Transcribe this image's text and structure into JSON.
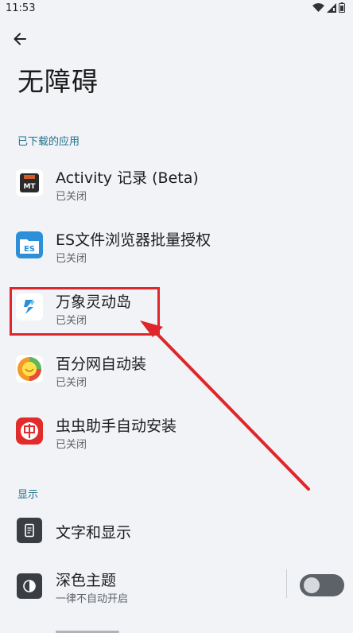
{
  "status_bar": {
    "time": "11:53",
    "icons": [
      "wifi-icon",
      "cell-signal-icon",
      "battery-icon"
    ]
  },
  "header": {
    "back_icon": "arrow-back-icon",
    "title": "无障碍"
  },
  "sections": {
    "downloaded": {
      "header": "已下载的应用",
      "items": [
        {
          "title": "Activity 记录 (Beta)",
          "subtitle": "已关闭",
          "icon": "mt-app-icon"
        },
        {
          "title": "ES文件浏览器批量授权",
          "subtitle": "已关闭",
          "icon": "es-file-explorer-icon"
        },
        {
          "title": "万象灵动岛",
          "subtitle": "已关闭",
          "icon": "wanxiang-dynamic-island-icon"
        },
        {
          "title": "百分网自动装",
          "subtitle": "已关闭",
          "icon": "baifenwang-icon"
        },
        {
          "title": "虫虫助手自动安装",
          "subtitle": "已关闭",
          "icon": "chongchong-icon"
        }
      ]
    },
    "display": {
      "header": "显示",
      "items": [
        {
          "title": "文字和显示",
          "icon": "text-display-icon"
        },
        {
          "title": "深色主题",
          "subtitle": "一律不自动开启",
          "icon": "dark-theme-icon",
          "toggle_on": false
        }
      ]
    }
  },
  "annotation": {
    "color": "#e0262a",
    "target": "万象灵动岛"
  },
  "colors": {
    "background": "#f1f3f6",
    "section_header": "#1f6f8b"
  }
}
